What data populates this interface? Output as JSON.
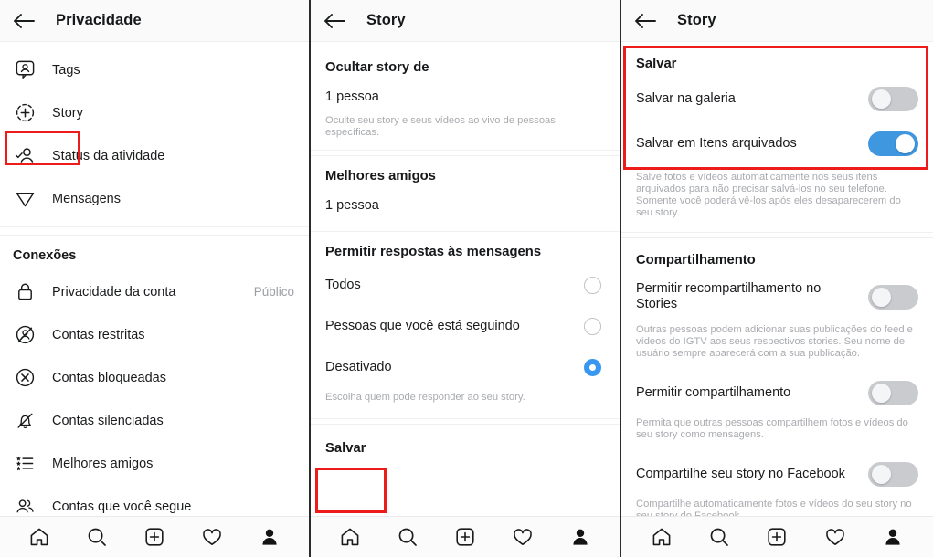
{
  "screens": [
    {
      "id": "privacy",
      "header": {
        "title": "Privacidade",
        "back_icon": "back-arrow-icon"
      },
      "items": [
        {
          "label": "Tags",
          "icon": "tags-icon",
          "value": ""
        },
        {
          "label": "Story",
          "icon": "story-plus-icon",
          "value": "",
          "highlighted": true
        },
        {
          "label": "Status da atividade",
          "icon": "activity-status-icon",
          "value": ""
        },
        {
          "label": "Mensagens",
          "icon": "paper-plane-icon",
          "value": ""
        }
      ],
      "group_title": "Conexões",
      "group_items": [
        {
          "label": "Privacidade da conta",
          "icon": "lock-icon",
          "value": "Público"
        },
        {
          "label": "Contas restritas",
          "icon": "restricted-account-icon",
          "value": ""
        },
        {
          "label": "Contas bloqueadas",
          "icon": "blocked-account-icon",
          "value": ""
        },
        {
          "label": "Contas silenciadas",
          "icon": "muted-bell-icon",
          "value": ""
        },
        {
          "label": "Melhores amigos",
          "icon": "best-friends-list-icon",
          "value": ""
        },
        {
          "label": "Contas que você segue",
          "icon": "people-icon",
          "value": ""
        }
      ]
    },
    {
      "id": "story-1",
      "header": {
        "title": "Story",
        "back_icon": "back-arrow-icon"
      },
      "hide_story": {
        "title": "Ocultar story de",
        "value": "1 pessoa",
        "helper": "Oculte seu story e seus vídeos ao vivo de pessoas específicas."
      },
      "close_friends": {
        "title": "Melhores amigos",
        "value": "1 pessoa"
      },
      "replies": {
        "title": "Permitir respostas às mensagens",
        "options": [
          {
            "label": "Todos",
            "selected": false
          },
          {
            "label": "Pessoas que você está seguindo",
            "selected": false
          },
          {
            "label": "Desativado",
            "selected": true
          }
        ],
        "helper": "Escolha quem pode responder ao seu story."
      },
      "save_section_title": "Salvar"
    },
    {
      "id": "story-2",
      "header": {
        "title": "Story",
        "back_icon": "back-arrow-icon"
      },
      "save": {
        "title": "Salvar",
        "toggles": [
          {
            "label": "Salvar na galeria",
            "on": false
          },
          {
            "label": "Salvar em Itens arquivados",
            "on": true
          }
        ],
        "helper": "Salve fotos e vídeos automaticamente nos seus itens arquivados para não precisar salvá-los no seu telefone. Somente você poderá vê-los após eles desaparecerem do seu story."
      },
      "sharing": {
        "title": "Compartilhamento",
        "rows": [
          {
            "label": "Permitir recompartilhamento no Stories",
            "on": false,
            "helper": "Outras pessoas podem adicionar suas publicações do feed e vídeos do IGTV aos seus respectivos stories. Seu nome de usuário sempre aparecerá com a sua publicação."
          },
          {
            "label": "Permitir compartilhamento",
            "on": false,
            "helper": "Permita que outras pessoas compartilhem fotos e vídeos do seu story como mensagens."
          },
          {
            "label": "Compartilhe seu story no Facebook",
            "on": false,
            "helper": "Compartilhe automaticamente fotos e vídeos do seu story no seu story do Facebook."
          }
        ]
      }
    }
  ],
  "bottom_nav": {
    "items": [
      {
        "icon": "home-icon",
        "label": "Início"
      },
      {
        "icon": "search-icon",
        "label": "Pesquisar"
      },
      {
        "icon": "add-post-icon",
        "label": "Adicionar"
      },
      {
        "icon": "heart-icon",
        "label": "Atividade"
      },
      {
        "icon": "profile-icon",
        "label": "Perfil"
      }
    ]
  },
  "colors": {
    "accent_blue": "#3897f0",
    "toggle_on": "#3f97e0",
    "toggle_off": "#c9cbcf",
    "annotation_red": "#ee1b1b",
    "muted_text": "#a9abaf"
  }
}
